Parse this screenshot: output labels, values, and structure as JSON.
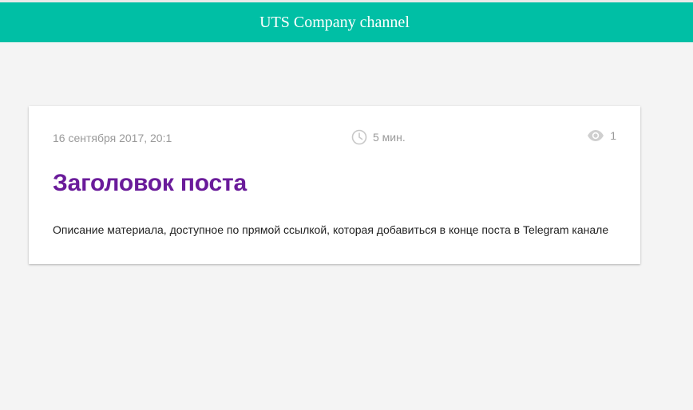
{
  "colors": {
    "header_bg": "#00bfa5",
    "page_bg": "#f4f4f4",
    "title_color": "#6a1b9a",
    "meta_color": "#9a9a9a",
    "icon_color": "#c8c8c8"
  },
  "header": {
    "title": "UTS Company channel"
  },
  "post": {
    "date": "16 сентября 2017, 20:1",
    "read_time": "5 мин.",
    "read_time_icon": "clock-icon",
    "views": "1",
    "views_icon": "eye-icon",
    "title": "Заголовок поста",
    "description": "Описание материала, доступное по прямой ссылкой, которая добавиться в конце поста в Telegram канале"
  }
}
